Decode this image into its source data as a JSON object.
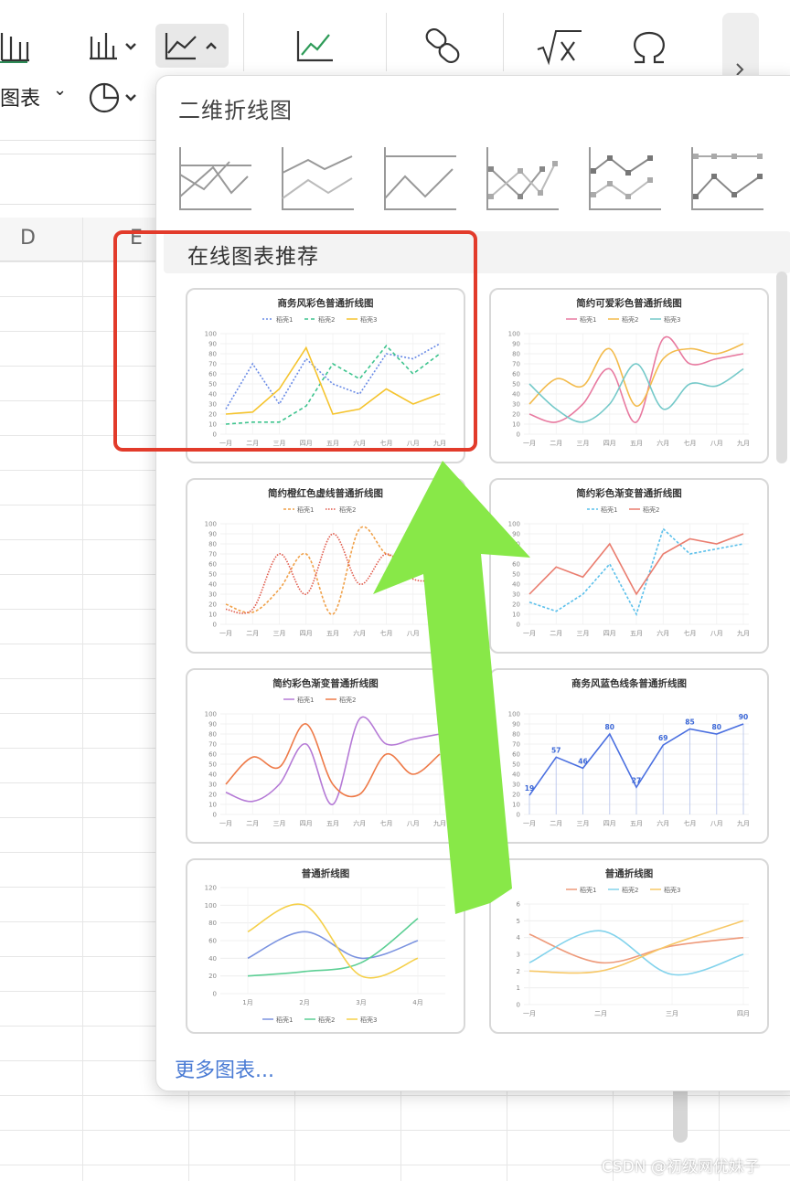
{
  "ribbon": {
    "chart_label": "图表",
    "chevron": "⌄"
  },
  "sheet": {
    "columns": [
      "D",
      "E"
    ]
  },
  "popup": {
    "section_2d_title": "二维折线图",
    "line_types": [
      "line",
      "stacked-line",
      "100%-stacked-line",
      "line-with-markers",
      "stacked-line-with-markers",
      "100%-stacked-line-with-markers"
    ],
    "section_recommend_title": "在线图表推荐",
    "more_link": "更多图表..."
  },
  "chart_data": [
    {
      "type": "line",
      "title": "商务风彩色普通折线图",
      "categories": [
        "一月",
        "二月",
        "三月",
        "四月",
        "五月",
        "六月",
        "七月",
        "八月",
        "九月"
      ],
      "ylim": [
        0,
        100
      ],
      "yticks": [
        0,
        10,
        20,
        30,
        40,
        50,
        60,
        70,
        80,
        90,
        100
      ],
      "series": [
        {
          "name": "稻壳1",
          "values": [
            25,
            70,
            30,
            75,
            50,
            40,
            80,
            75,
            90
          ],
          "color": "#6a8be6",
          "dash": "2,2",
          "smooth": false
        },
        {
          "name": "稻壳2",
          "values": [
            10,
            12,
            12,
            28,
            70,
            55,
            88,
            60,
            80
          ],
          "color": "#3ec48e",
          "dash": "4,3",
          "smooth": false
        },
        {
          "name": "稻壳3",
          "values": [
            20,
            22,
            45,
            86,
            20,
            25,
            45,
            30,
            40
          ],
          "color": "#f5c42e",
          "dash": "",
          "smooth": false
        }
      ]
    },
    {
      "type": "line",
      "title": "简约可爱彩色普通折线图",
      "categories": [
        "一月",
        "二月",
        "三月",
        "四月",
        "五月",
        "六月",
        "七月",
        "八月",
        "九月"
      ],
      "ylim": [
        0,
        100
      ],
      "yticks": [
        0,
        10,
        20,
        30,
        40,
        50,
        60,
        70,
        80,
        90,
        100
      ],
      "series": [
        {
          "name": "稻壳1",
          "values": [
            20,
            12,
            30,
            65,
            12,
            95,
            70,
            75,
            80
          ],
          "color": "#e87aa0",
          "dash": "",
          "smooth": true
        },
        {
          "name": "稻壳2",
          "values": [
            30,
            55,
            48,
            85,
            28,
            75,
            85,
            80,
            90
          ],
          "color": "#f3bb4c",
          "dash": "",
          "smooth": true
        },
        {
          "name": "稻壳3",
          "values": [
            50,
            25,
            12,
            30,
            70,
            25,
            50,
            48,
            65
          ],
          "color": "#74c9c9",
          "dash": "",
          "smooth": true
        }
      ]
    },
    {
      "type": "line",
      "title": "简约橙红色虚线普通折线图",
      "categories": [
        "一月",
        "二月",
        "三月",
        "四月",
        "五月",
        "六月",
        "七月",
        "八月",
        "九月"
      ],
      "ylim": [
        0,
        100
      ],
      "yticks": [
        0,
        10,
        20,
        30,
        40,
        50,
        60,
        70,
        80,
        90,
        100
      ],
      "series": [
        {
          "name": "稻壳1",
          "values": [
            20,
            12,
            35,
            70,
            10,
            95,
            70,
            65,
            45
          ],
          "color": "#f0a14a",
          "dash": "3,2",
          "smooth": true
        },
        {
          "name": "稻壳2",
          "values": [
            15,
            15,
            70,
            30,
            90,
            40,
            70,
            45,
            45
          ],
          "color": "#e0594a",
          "dash": "1.5,1.5",
          "smooth": true
        }
      ]
    },
    {
      "type": "line",
      "title": "简约彩色渐变普通折线图",
      "categories": [
        "一月",
        "二月",
        "三月",
        "四月",
        "五月",
        "六月",
        "七月",
        "八月",
        "九月"
      ],
      "ylim": [
        0,
        100
      ],
      "yticks": [
        0,
        10,
        20,
        30,
        40,
        50,
        60,
        70,
        80,
        90,
        100
      ],
      "series": [
        {
          "name": "稻壳1",
          "values": [
            22,
            13,
            30,
            60,
            10,
            95,
            70,
            75,
            80
          ],
          "color": "#5bc0eb",
          "dash": "3,2",
          "smooth": false
        },
        {
          "name": "稻壳2",
          "values": [
            30,
            57,
            47,
            80,
            30,
            70,
            85,
            80,
            90
          ],
          "color": "#ea7d6f",
          "dash": "",
          "smooth": false
        }
      ]
    },
    {
      "type": "line",
      "title": "简约彩色渐变普通折线图",
      "categories": [
        "一月",
        "二月",
        "三月",
        "四月",
        "五月",
        "六月",
        "七月",
        "八月",
        "九月"
      ],
      "ylim": [
        0,
        100
      ],
      "yticks": [
        0,
        10,
        20,
        30,
        40,
        50,
        60,
        70,
        80,
        90,
        100
      ],
      "series": [
        {
          "name": "稻壳1",
          "values": [
            22,
            13,
            30,
            70,
            10,
            95,
            70,
            75,
            80
          ],
          "color": "#b57ad6",
          "dash": "",
          "smooth": true
        },
        {
          "name": "稻壳2",
          "values": [
            30,
            57,
            47,
            90,
            30,
            20,
            60,
            40,
            60
          ],
          "color": "#ee7a48",
          "dash": "",
          "smooth": true
        }
      ]
    },
    {
      "type": "line",
      "title": "商务风蓝色线条普通折线图",
      "categories": [
        "一月",
        "二月",
        "三月",
        "四月",
        "五月",
        "六月",
        "七月",
        "八月",
        "九月"
      ],
      "ylim": [
        0,
        100
      ],
      "yticks": [
        0,
        10,
        20,
        30,
        40,
        50,
        60,
        70,
        80,
        90,
        100
      ],
      "data_labels": true,
      "series": [
        {
          "name": "",
          "values": [
            19,
            57,
            46,
            80,
            27,
            69,
            85,
            80,
            90
          ],
          "color": "#4a6fe0",
          "dash": "",
          "smooth": false
        }
      ]
    },
    {
      "type": "line",
      "title": "普通折线图",
      "categories": [
        "1月",
        "2月",
        "3月",
        "4月"
      ],
      "ylim": [
        0,
        120
      ],
      "yticks": [
        0,
        20,
        40,
        60,
        80,
        100,
        120
      ],
      "legend": "bottom",
      "series": [
        {
          "name": "稻壳1",
          "values": [
            40,
            70,
            40,
            60
          ],
          "color": "#7b93e0",
          "dash": "",
          "smooth": true
        },
        {
          "name": "稻壳2",
          "values": [
            20,
            25,
            35,
            85
          ],
          "color": "#5ccf94",
          "dash": "",
          "smooth": true
        },
        {
          "name": "稻壳3",
          "values": [
            70,
            100,
            20,
            40
          ],
          "color": "#f5d04a",
          "dash": "",
          "smooth": true
        }
      ]
    },
    {
      "type": "line",
      "title": "普通折线图",
      "categories": [
        "一月",
        "二月",
        "三月",
        "四月"
      ],
      "ylim": [
        0,
        6
      ],
      "yticks": [
        0,
        1,
        2,
        3,
        4,
        5,
        6
      ],
      "series": [
        {
          "name": "稻壳1",
          "values": [
            4.2,
            2.5,
            3.5,
            4.0
          ],
          "color": "#ee9a7a",
          "dash": "",
          "smooth": true
        },
        {
          "name": "稻壳2",
          "values": [
            2.5,
            4.4,
            1.8,
            3.0
          ],
          "color": "#83d3ec",
          "dash": "",
          "smooth": true
        },
        {
          "name": "稻壳3",
          "values": [
            2.0,
            2.0,
            3.6,
            5.0
          ],
          "color": "#f7c867",
          "dash": "",
          "smooth": true
        }
      ]
    }
  ],
  "watermark": "CSDN @初级网优妹子",
  "colors": {
    "highlight": "#e23b2b",
    "arrow": "#88e848",
    "link": "#4a7bd4"
  }
}
